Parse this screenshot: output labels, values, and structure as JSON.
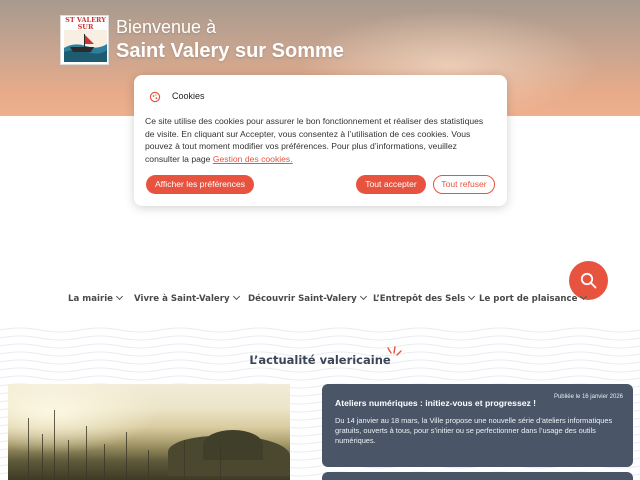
{
  "header": {
    "logo_text": "ST VALERY SUR SOMME",
    "welcome": "Bienvenue à",
    "town": "Saint Valery sur Somme"
  },
  "cookie_banner": {
    "title": "Cookies",
    "body": "Ce site utilise des cookies pour assurer le bon fonctionnement et réaliser des statistiques de visite. En cliquant sur Accepter, vous consentez à l’utilisation de ces cookies. Vous pouvez à tout moment modifier vos préférences. Pour plus d’informations, veuillez consulter la page ",
    "link": "Gestion des cookies.",
    "preferences_button": "Afficher les préférences",
    "accept_button": "Tout accepter",
    "refuse_button": "Tout refuser"
  },
  "nav": {
    "items": [
      {
        "label": "La mairie"
      },
      {
        "label": "Vivre à Saint-Valery"
      },
      {
        "label": "Découvrir Saint-Valery"
      },
      {
        "label": "L’Entrepôt des Sels"
      },
      {
        "label": "Le port de plaisance"
      }
    ]
  },
  "news_section": {
    "title": "L’actualité valericaine",
    "card": {
      "date": "Publiée le 16 janvier 2026",
      "title": "Ateliers numériques : initiez-vous et progressez !",
      "body": "Du 14 janvier au 18 mars, la Ville propose une nouvelle série d’ateliers informatiques gratuits, ouverts à tous, pour s’initier ou se perfectionner dans l’usage des outils numériques."
    }
  },
  "colors": {
    "accent": "#e8533f",
    "card": "#4a5668",
    "title": "#3a4656"
  },
  "icons": {
    "cookie": "cookie-icon",
    "search": "search-icon",
    "chevron": "chevron-down-icon"
  }
}
